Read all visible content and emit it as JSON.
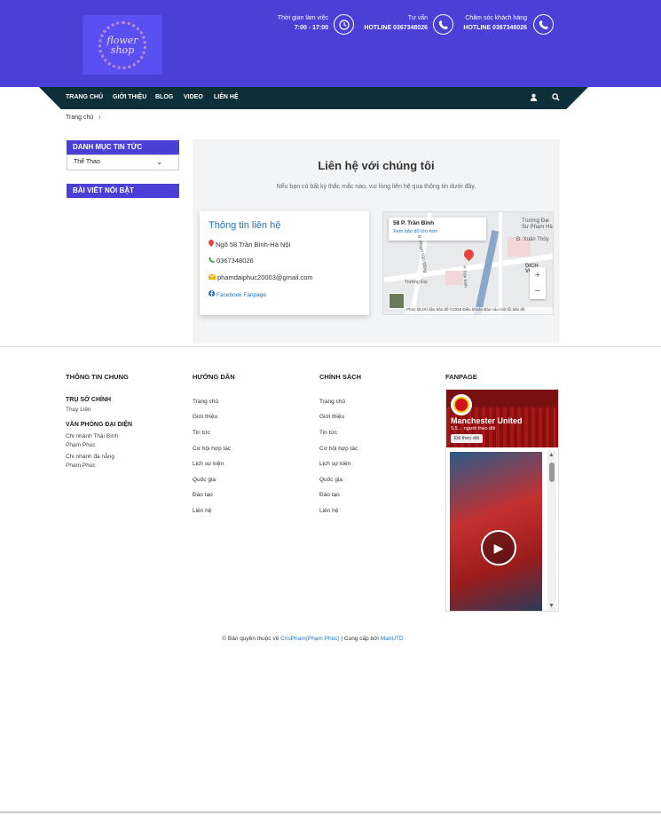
{
  "header": {
    "logo_text": "flower shop",
    "working_hours": {
      "label": "Thời gian làm việc",
      "value": "7:00 - 17:00"
    },
    "consult": {
      "label": "Tư vấn",
      "value": "HOTLINE 0367348026"
    },
    "support": {
      "label": "Chăm sóc khách hàng",
      "value": "HOTLINE 0367348026"
    }
  },
  "nav": {
    "items": [
      "TRANG CHỦ",
      "GIỚI THIỆU",
      "BLOG",
      "VIDEO",
      "LIÊN HỆ"
    ],
    "user_icon": "user-icon",
    "search_icon": "search-icon"
  },
  "breadcrumb": {
    "home": "Trang chủ"
  },
  "sidebar": {
    "news_category": {
      "title": "DANH MỤC TIN TỨC",
      "selected": "Thể Thao"
    },
    "featured": {
      "title": "BÀI VIẾT NỔI BẬT"
    }
  },
  "contact": {
    "title": "Liên hệ với chúng tôi",
    "subtitle": "Nếu bạn có bất kỳ thắc mắc nào, vui lòng liên hệ qua thông tin dưới đây.",
    "card": {
      "title": "Thông tin liên hệ",
      "address": "Ngõ 58 Trần Bình-Hà Nội",
      "phone": "0367348026",
      "email": "phamdaiphuc20003@gmail.com",
      "facebook": "Facebook Fanpage"
    },
    "map": {
      "place": "58 P. Trần Bình",
      "link": "Xem bản đồ lớn hơn",
      "labels": [
        "Trường Đại Sư Phạm Hà",
        "Đ. Xuân Thủy",
        "DỊCH VỌNG",
        "Đ. Phạm Văn Đồng",
        "Trường Đại",
        "P. Trần Bình"
      ],
      "footer": "Phím tắt  Dữ liệu bản đồ ©2025  Điều khoản  Báo cáo một lỗi bản đồ",
      "zoom_in": "+",
      "zoom_out": "−"
    }
  },
  "footer": {
    "col1": {
      "title": "THÔNG TIN CHUNG",
      "hq_title": "TRỤ SỞ CHÍNH",
      "hq_value": "Thụy Liên",
      "rep_title": "VĂN PHÒNG ĐẠI DIỆN",
      "branch1": "Chi nhánh Thái Bình",
      "branch1_person": "Phạm Phúc",
      "branch2": "Chi nhánh đà nẵng",
      "branch2_person": "Phạm Phúc"
    },
    "col2": {
      "title": "HƯỚNG DẪN",
      "links": [
        "Trang chủ",
        "Giới thiệu",
        "Tin tức",
        "Cơ hội hợp tác",
        "Lịch sự kiện",
        "Quốc gia",
        "Đào tạo",
        "Liên hệ"
      ]
    },
    "col3": {
      "title": "CHÍNH SÁCH",
      "links": [
        "Trang chủ",
        "Giới thiệu",
        "Tin tức",
        "Cơ hội hợp tác",
        "Lịch sự kiện",
        "Quốc gia",
        "Đào tạo",
        "Liên hệ"
      ]
    },
    "col4": {
      "title": "FANPAGE",
      "page_name": "Manchester United",
      "followers": "9,5… người theo dõi",
      "follow_label": "Đã theo dõi"
    }
  },
  "copyright": {
    "prefix": "© Bản quyền thuộc về ",
    "author": "CrisPham(Phạm Phúc)",
    "middle": " | Cung cấp bởi ",
    "provider": "ManUTD"
  },
  "colors": {
    "primary": "#4a3fd6",
    "nav": "#0d2f3a",
    "link": "#1a73c8"
  }
}
